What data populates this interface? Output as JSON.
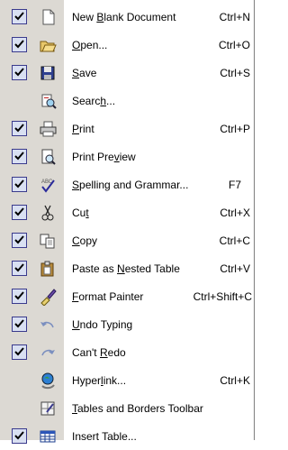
{
  "menu": {
    "items": [
      {
        "before": "New ",
        "mn": "B",
        "after": "lank Document",
        "shortcut": "Ctrl+N",
        "checked": true,
        "icon": "new-blank-document-icon"
      },
      {
        "before": "",
        "mn": "O",
        "after": "pen...",
        "shortcut": "Ctrl+O",
        "checked": true,
        "icon": "open-folder-icon"
      },
      {
        "before": "",
        "mn": "S",
        "after": "ave",
        "shortcut": "Ctrl+S",
        "checked": true,
        "icon": "save-disk-icon"
      },
      {
        "before": "Searc",
        "mn": "h",
        "after": "...",
        "shortcut": "",
        "checked": false,
        "icon": "search-document-icon"
      },
      {
        "before": "",
        "mn": "P",
        "after": "rint",
        "shortcut": "Ctrl+P",
        "checked": true,
        "icon": "printer-icon"
      },
      {
        "before": "Print Pre",
        "mn": "v",
        "after": "iew",
        "shortcut": "",
        "checked": true,
        "icon": "print-preview-icon"
      },
      {
        "before": "",
        "mn": "S",
        "after": "pelling and Grammar...",
        "shortcut": "F7",
        "checked": true,
        "icon": "spelling-grammar-icon"
      },
      {
        "before": "Cu",
        "mn": "t",
        "after": "",
        "shortcut": "Ctrl+X",
        "checked": true,
        "icon": "scissors-icon"
      },
      {
        "before": "",
        "mn": "C",
        "after": "opy",
        "shortcut": "Ctrl+C",
        "checked": true,
        "icon": "copy-icon"
      },
      {
        "before": "Paste as ",
        "mn": "N",
        "after": "ested Table",
        "shortcut": "Ctrl+V",
        "checked": true,
        "icon": "clipboard-icon"
      },
      {
        "before": "",
        "mn": "F",
        "after": "ormat Painter",
        "shortcut": "Ctrl+Shift+C",
        "checked": true,
        "icon": "paintbrush-icon"
      },
      {
        "before": "",
        "mn": "U",
        "after": "ndo Typing",
        "shortcut": "",
        "checked": true,
        "icon": "undo-arrow-icon"
      },
      {
        "before": "Can't ",
        "mn": "R",
        "after": "edo",
        "shortcut": "",
        "checked": true,
        "icon": "redo-arrow-icon"
      },
      {
        "before": "Hyper",
        "mn": "l",
        "after": "ink...",
        "shortcut": "Ctrl+K",
        "checked": false,
        "icon": "hyperlink-globe-icon"
      },
      {
        "before": "",
        "mn": "T",
        "after": "ables and Borders Toolbar",
        "shortcut": "",
        "checked": false,
        "icon": "tables-borders-icon"
      },
      {
        "before": "Insert Table...",
        "mn": "",
        "after": "",
        "shortcut": "",
        "checked": true,
        "icon": "insert-table-icon"
      }
    ]
  }
}
